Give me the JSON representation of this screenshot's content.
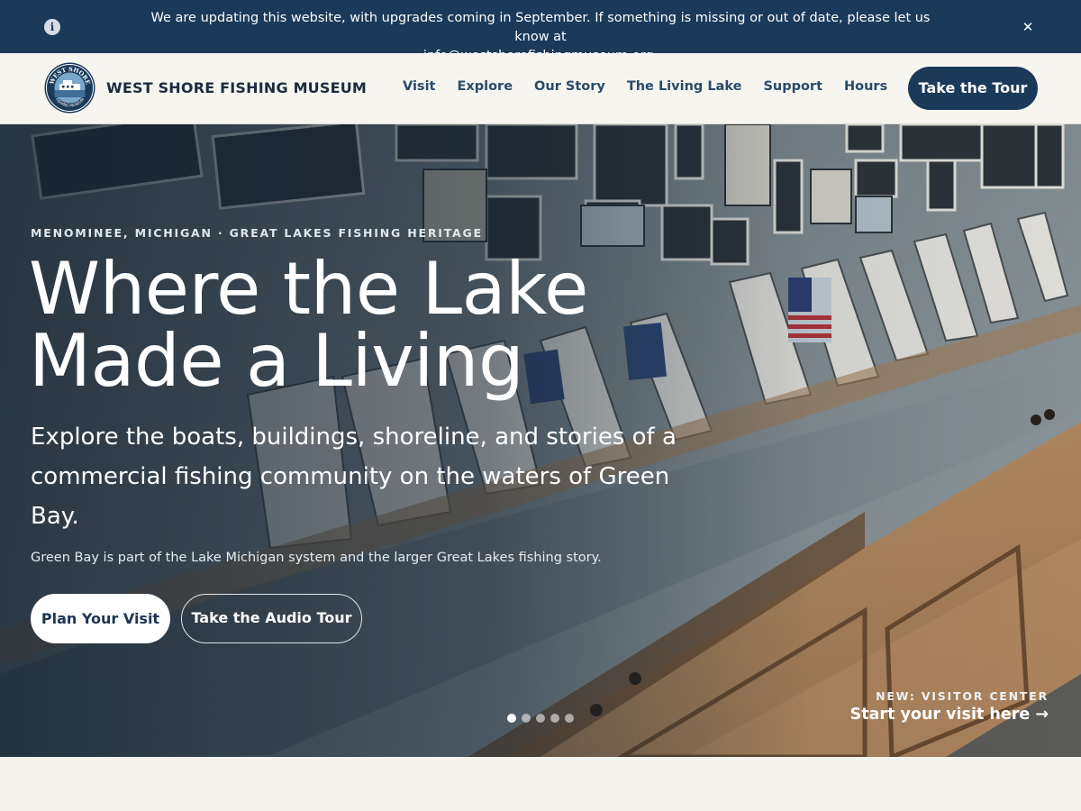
{
  "banner": {
    "info_icon": "info-icon",
    "text": "We are updating this website, with upgrades coming in September. If something is missing or out of date, please let us know at",
    "email": "info@westshorefishingmuseum.org",
    "trail": ".",
    "close_icon": "close-icon",
    "close_glyph": "✕"
  },
  "header": {
    "logo_text_top": "WEST SHORE",
    "logo_text_bottom": "FISHING MUSEUM",
    "brand": "WEST SHORE FISHING MUSEUM",
    "nav": [
      "Visit",
      "Explore",
      "Our Story",
      "The Living Lake",
      "Support",
      "Hours"
    ],
    "cta": "Take the Tour"
  },
  "hero": {
    "eyebrow": "MENOMINEE, MICHIGAN · GREAT LAKES FISHING HERITAGE",
    "headline_line1": "Where the Lake",
    "headline_line2": "Made a Living",
    "lede": "Explore the boats, buildings, shoreline, and stories of a commercial fishing community on the waters of Green Bay.",
    "note": "Green Bay is part of the Lake Michigan system and the larger Great Lakes fishing story.",
    "primary_button": "Plan Your Visit",
    "secondary_button": "Take the Audio Tour",
    "slides_total": 5,
    "active_slide": 1,
    "promo_label": "NEW: VISITOR CENTER",
    "promo_link": "Start your visit here →"
  },
  "colors": {
    "navy": "#1b3a5a",
    "page_background": "#f4f3ee",
    "header_background": "#f6f5ef",
    "nav_text": "#2b4a6a"
  }
}
